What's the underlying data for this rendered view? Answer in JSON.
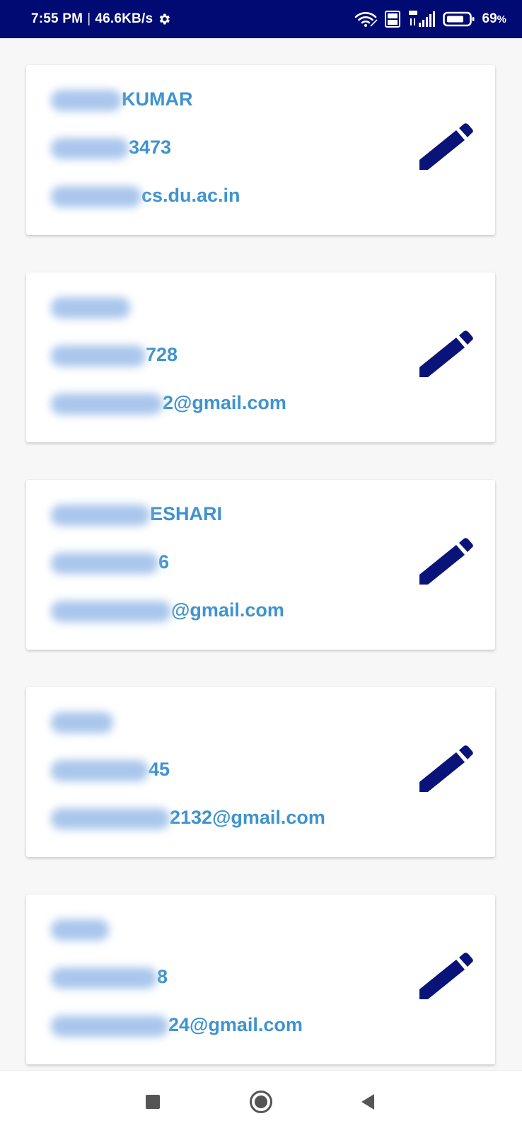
{
  "status_bar": {
    "time": "7:55 PM",
    "separator": "|",
    "net_speed": "46.6KB/s",
    "battery_percent": "69",
    "battery_unit": "%",
    "icons": [
      "gear-icon",
      "wifi-icon",
      "volte-icon",
      "signal-4g-icon",
      "battery-icon"
    ]
  },
  "contacts": [
    {
      "name": "KUMAR",
      "phone": "3473",
      "email": "cs.du.ac.in"
    },
    {
      "name": "",
      "phone": "728",
      "email": "2@gmail.com"
    },
    {
      "name": "ESHARI",
      "phone": "6",
      "email": "@gmail.com"
    },
    {
      "name": "",
      "phone": "45",
      "email": "2132@gmail.com"
    },
    {
      "name": "",
      "phone": "8",
      "email": "24@gmail.com"
    }
  ],
  "colors": {
    "status_bar_bg": "#000a73",
    "text_accent": "#3f93cf",
    "edit_icon": "#0a1378",
    "page_bg": "#f7f7f7"
  },
  "nav_bar": {
    "icons": [
      "recents-icon",
      "home-icon",
      "back-icon"
    ]
  }
}
